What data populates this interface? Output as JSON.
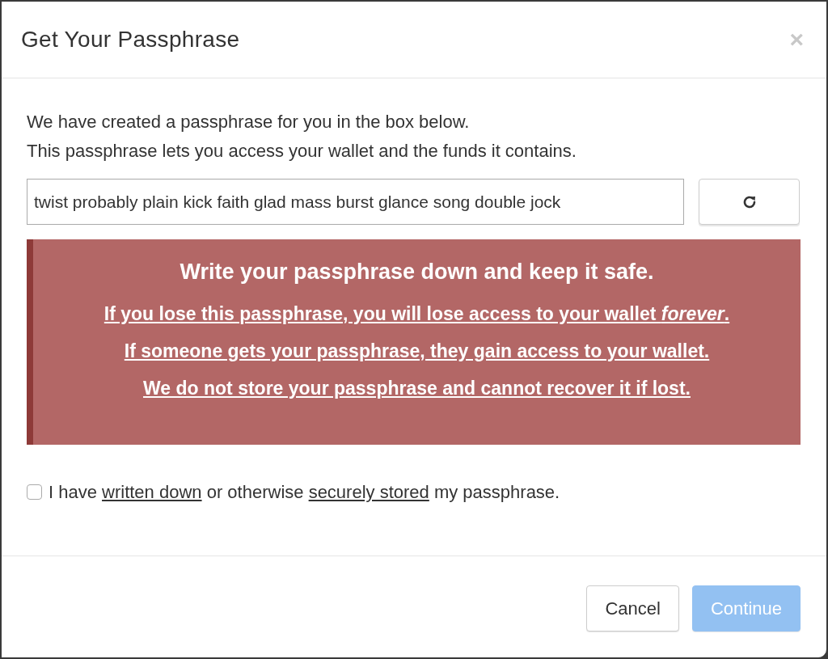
{
  "dialog": {
    "title": "Get Your Passphrase",
    "close": "×"
  },
  "intro": [
    "We have created a passphrase for you in the box below.",
    "This passphrase lets you access your wallet and the funds it contains."
  ],
  "passphrase": {
    "value": "twist probably plain kick faith glad mass burst glance song double jock"
  },
  "warning": {
    "title": "Write your passphrase down and keep it safe.",
    "lines": [
      "If you lose this passphrase, you will lose access to your wallet *forever*.",
      "If someone gets your passphrase, they gain access to your wallet.",
      "We do not store your passphrase and cannot recover it if lost."
    ]
  },
  "confirm": {
    "checked": false,
    "parts": [
      {
        "kind": "plain",
        "text": "I have "
      },
      {
        "kind": "link",
        "text": "written down"
      },
      {
        "kind": "plain",
        "text": " or otherwise "
      },
      {
        "kind": "link",
        "text": "securely stored"
      },
      {
        "kind": "plain",
        "text": " my passphrase."
      }
    ]
  },
  "buttons": [
    {
      "kind": "default",
      "label": "Cancel",
      "disabled": false
    },
    {
      "kind": "primary",
      "label": "Continue",
      "disabled": true
    }
  ]
}
